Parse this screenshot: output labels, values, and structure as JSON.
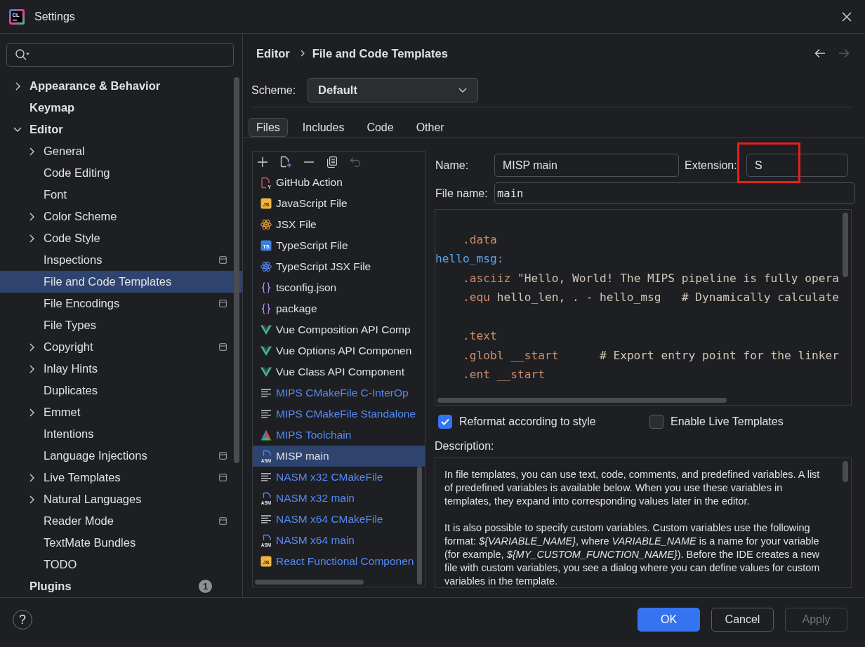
{
  "window": {
    "title": "Settings",
    "logo_text": "CL"
  },
  "sidebar": {
    "items": [
      {
        "label": "Appearance & Behavior",
        "kind": "branch",
        "expanded": false,
        "selected": false,
        "project_level": false
      },
      {
        "label": "Keymap",
        "kind": "leaf",
        "selected": false,
        "project_level": false
      },
      {
        "label": "Editor",
        "kind": "branch",
        "expanded": true,
        "selected": false,
        "project_level": false,
        "children": [
          {
            "label": "General",
            "kind": "branch",
            "expanded": false,
            "selected": false,
            "project_level": false
          },
          {
            "label": "Code Editing",
            "kind": "leaf",
            "selected": false,
            "project_level": false
          },
          {
            "label": "Font",
            "kind": "leaf",
            "selected": false,
            "project_level": false
          },
          {
            "label": "Color Scheme",
            "kind": "branch",
            "expanded": false,
            "selected": false,
            "project_level": false
          },
          {
            "label": "Code Style",
            "kind": "branch",
            "expanded": false,
            "selected": false,
            "project_level": false
          },
          {
            "label": "Inspections",
            "kind": "leaf",
            "selected": false,
            "project_level": true
          },
          {
            "label": "File and Code Templates",
            "kind": "leaf",
            "selected": true,
            "project_level": false
          },
          {
            "label": "File Encodings",
            "kind": "leaf",
            "selected": false,
            "project_level": true
          },
          {
            "label": "File Types",
            "kind": "leaf",
            "selected": false,
            "project_level": false
          },
          {
            "label": "Copyright",
            "kind": "branch",
            "expanded": false,
            "selected": false,
            "project_level": true
          },
          {
            "label": "Inlay Hints",
            "kind": "branch",
            "expanded": false,
            "selected": false,
            "project_level": false
          },
          {
            "label": "Duplicates",
            "kind": "leaf",
            "selected": false,
            "project_level": false
          },
          {
            "label": "Emmet",
            "kind": "branch",
            "expanded": false,
            "selected": false,
            "project_level": false
          },
          {
            "label": "Intentions",
            "kind": "leaf",
            "selected": false,
            "project_level": false
          },
          {
            "label": "Language Injections",
            "kind": "leaf",
            "selected": false,
            "project_level": true
          },
          {
            "label": "Live Templates",
            "kind": "branch",
            "expanded": false,
            "selected": false,
            "project_level": true
          },
          {
            "label": "Natural Languages",
            "kind": "branch",
            "expanded": false,
            "selected": false,
            "project_level": false
          },
          {
            "label": "Reader Mode",
            "kind": "leaf",
            "selected": false,
            "project_level": true
          },
          {
            "label": "TextMate Bundles",
            "kind": "leaf",
            "selected": false,
            "project_level": false
          },
          {
            "label": "TODO",
            "kind": "leaf",
            "selected": false,
            "project_level": false
          }
        ]
      },
      {
        "label": "Plugins",
        "kind": "leaf",
        "selected": false,
        "project_level": false,
        "badge": "1"
      }
    ]
  },
  "breadcrumb": [
    "Editor",
    "File and Code Templates"
  ],
  "nav": [
    {
      "kind": "back",
      "disabled": false
    },
    {
      "kind": "forward",
      "disabled": true
    }
  ],
  "scheme": {
    "label": "Scheme:",
    "value": "Default"
  },
  "tabs": [
    {
      "label": "Files",
      "selected": true
    },
    {
      "label": "Includes",
      "selected": false
    },
    {
      "label": "Code",
      "selected": false
    },
    {
      "label": "Other",
      "selected": false
    }
  ],
  "templates": {
    "toolbar": [
      {
        "kind": "add",
        "disabled": false
      },
      {
        "kind": "create",
        "disabled": false
      },
      {
        "kind": "remove",
        "disabled": false
      },
      {
        "kind": "copy",
        "disabled": false
      },
      {
        "kind": "reset",
        "disabled": true
      }
    ],
    "items": [
      {
        "label": "GitHub Action",
        "kind": "workflow",
        "icon_text": "Y",
        "custom": false,
        "selected": false
      },
      {
        "label": "JavaScript File",
        "kind": "javascript",
        "icon_text": "JS",
        "custom": false,
        "selected": false
      },
      {
        "label": "JSX File",
        "kind": "jsx",
        "custom": false,
        "selected": false
      },
      {
        "label": "TypeScript File",
        "kind": "typescript",
        "icon_text": "TS",
        "custom": false,
        "selected": false
      },
      {
        "label": "TypeScript JSX File",
        "kind": "tsx",
        "custom": false,
        "selected": false
      },
      {
        "label": "tsconfig.json",
        "kind": "json",
        "custom": false,
        "selected": false
      },
      {
        "label": "package",
        "kind": "json",
        "custom": false,
        "selected": false
      },
      {
        "label": "Vue Composition API Comp",
        "kind": "vue",
        "custom": false,
        "selected": false
      },
      {
        "label": "Vue Options API Componen",
        "kind": "vue",
        "custom": false,
        "selected": false
      },
      {
        "label": "Vue Class API Component",
        "kind": "vue",
        "custom": false,
        "selected": false
      },
      {
        "label": "MIPS CMakeFile C-InterOp",
        "kind": "text",
        "custom": true,
        "selected": false
      },
      {
        "label": "MIPS CMakeFile Standalone",
        "kind": "text",
        "custom": true,
        "selected": false
      },
      {
        "label": "MIPS Toolchain",
        "kind": "cmake",
        "custom": true,
        "selected": false
      },
      {
        "label": "MISP main",
        "kind": "asm",
        "icon_text": "ASM",
        "custom": false,
        "selected": true
      },
      {
        "label": "NASM x32 CMakeFile",
        "kind": "text",
        "custom": true,
        "selected": false
      },
      {
        "label": "NASM x32 main",
        "kind": "asm",
        "icon_text": "ASM",
        "custom": true,
        "selected": false
      },
      {
        "label": "NASM x64 CMakeFile",
        "kind": "text",
        "custom": true,
        "selected": false
      },
      {
        "label": "NASM x64 main",
        "kind": "asm",
        "icon_text": "ASM",
        "custom": true,
        "selected": false
      },
      {
        "label": "React Functional Componen",
        "kind": "javascript",
        "icon_text": "JS",
        "custom": true,
        "selected": false
      }
    ]
  },
  "form": {
    "name": {
      "label": "Name:",
      "value": "MISP main"
    },
    "extension": {
      "label": "Extension:",
      "value": "S",
      "highlighted": true
    },
    "file_name": {
      "label": "File name:",
      "value": "main"
    }
  },
  "editor": {
    "lines": [
      {
        "kind": "blank"
      },
      {
        "kind": "code",
        "indented": true,
        "segments": [
          {
            "kind": "directive",
            "text": ".data"
          }
        ]
      },
      {
        "kind": "code",
        "indented": false,
        "segments": [
          {
            "kind": "label",
            "text": "hello_msg:"
          }
        ]
      },
      {
        "kind": "code",
        "indented": true,
        "segments": [
          {
            "kind": "directive",
            "text": ".asciiz"
          },
          {
            "kind": "plain",
            "text": " \"Hello, World! The MIPS pipeline is fully opera"
          }
        ]
      },
      {
        "kind": "code",
        "indented": true,
        "segments": [
          {
            "kind": "directive",
            "text": ".equ"
          },
          {
            "kind": "plain",
            "text": " hello_len, . - hello_msg   # Dynamically calculate"
          }
        ]
      },
      {
        "kind": "blank"
      },
      {
        "kind": "code",
        "indented": true,
        "segments": [
          {
            "kind": "directive",
            "text": ".text"
          }
        ]
      },
      {
        "kind": "code",
        "indented": true,
        "segments": [
          {
            "kind": "directive",
            "text": ".globl __start"
          },
          {
            "kind": "plain",
            "text": "      # Export entry point for the linker"
          }
        ]
      },
      {
        "kind": "code",
        "indented": true,
        "segments": [
          {
            "kind": "directive",
            "text": ".ent __start"
          }
        ]
      }
    ]
  },
  "options": [
    {
      "label": "Reformat according to style",
      "checked": true
    },
    {
      "label": "Enable Live Templates",
      "checked": false
    }
  ],
  "description": {
    "label": "Description:",
    "paragraphs": [
      "In file templates, you can use text, code, comments, and predefined variables. A list of predefined variables is available below. When you use these variables in templates, they expand into corresponding values later in the editor.",
      "It is also possible to specify custom variables. Custom variables use the following format: *${VARIABLE_NAME}*, where *VARIABLE_NAME* is a name for your variable (for example, *${MY_CUSTOM_FUNCTION_NAME}*). Before the IDE creates a new file with custom variables, you see a dialog where you can define values for custom variables in the template."
    ]
  },
  "footer": {
    "help": "?",
    "buttons": [
      {
        "label": "OK",
        "kind": "primary",
        "disabled": false
      },
      {
        "label": "Cancel",
        "kind": "secondary",
        "disabled": false
      },
      {
        "label": "Apply",
        "kind": "secondary",
        "disabled": true
      }
    ]
  }
}
